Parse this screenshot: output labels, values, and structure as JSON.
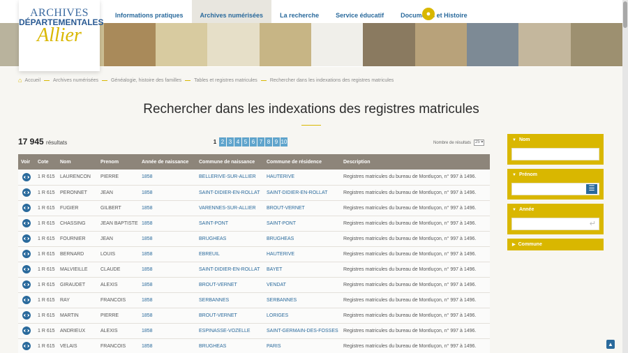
{
  "logo": {
    "line1": "ARCHIVES",
    "line2": "DÉPARTEMENTALES",
    "line3": "Allier"
  },
  "nav": [
    {
      "label": "Informations pratiques",
      "active": false
    },
    {
      "label": "Archives numérisées",
      "active": true
    },
    {
      "label": "La recherche",
      "active": false
    },
    {
      "label": "Service éducatif",
      "active": false
    },
    {
      "label": "Documents et Histoire",
      "active": false
    }
  ],
  "banner_colors": [
    "#b9b39d",
    "#cdbf94",
    "#a98a5a",
    "#d8cba0",
    "#e6dfc8",
    "#c7b585",
    "#f0efea",
    "#8a7a60",
    "#b8a27a",
    "#7d8a95",
    "#c4b79d",
    "#9d9070"
  ],
  "breadcrumb": [
    "Accueil",
    "Archives numérisées",
    "Généalogie, histoire des familles",
    "Tables et registres matricules",
    "Rechercher dans les indexations des registres matricules"
  ],
  "page_title": "Rechercher dans les indexations des registres matricules",
  "results": {
    "count": "17 945",
    "label": "résultats"
  },
  "pager": {
    "current": "1",
    "pages": [
      "2",
      "3",
      "4",
      "5",
      "6",
      "7",
      "8",
      "9",
      "10"
    ]
  },
  "per_page": {
    "label": "Nombre de résultats",
    "value": "25"
  },
  "table": {
    "headers": [
      "Voir",
      "Cote",
      "Nom",
      "Prenom",
      "Année de naissance",
      "Commune de naissance",
      "Commune de résidence",
      "Description"
    ],
    "rows": [
      [
        "1 R 615",
        "LAURENCON",
        "PIERRE",
        "1858",
        "BELLERIVE-SUR-ALLIER",
        "HAUTERIVE",
        "Registres matricules du bureau de Montluçon, n° 997 à 1496."
      ],
      [
        "1 R 615",
        "PERONNET",
        "JEAN",
        "1858",
        "SAINT-DIDIER-EN-ROLLAT",
        "SAINT-DIDIER-EN-ROLLAT",
        "Registres matricules du bureau de Montluçon, n° 997 à 1496."
      ],
      [
        "1 R 615",
        "FUGIER",
        "GILBERT",
        "1858",
        "VARENNES-SUR-ALLIER",
        "BROUT-VERNET",
        "Registres matricules du bureau de Montluçon, n° 997 à 1496."
      ],
      [
        "1 R 615",
        "CHASSING",
        "JEAN BAPTISTE",
        "1858",
        "SAINT-PONT",
        "SAINT-PONT",
        "Registres matricules du bureau de Montluçon, n° 997 à 1496."
      ],
      [
        "1 R 615",
        "FOURNIER",
        "JEAN",
        "1858",
        "BRUGHEAS",
        "BRUGHEAS",
        "Registres matricules du bureau de Montluçon, n° 997 à 1496."
      ],
      [
        "1 R 615",
        "BERNARD",
        "LOUIS",
        "1858",
        "EBREUIL",
        "HAUTERIVE",
        "Registres matricules du bureau de Montluçon, n° 997 à 1496."
      ],
      [
        "1 R 615",
        "MALVIEILLE",
        "CLAUDE",
        "1858",
        "SAINT-DIDIER-EN-ROLLAT",
        "BAYET",
        "Registres matricules du bureau de Montluçon, n° 997 à 1496."
      ],
      [
        "1 R 615",
        "GIRAUDET",
        "ALEXIS",
        "1858",
        "BROUT-VERNET",
        "VENDAT",
        "Registres matricules du bureau de Montluçon, n° 997 à 1496."
      ],
      [
        "1 R 615",
        "RAY",
        "FRANCOIS",
        "1858",
        "SERBANNES",
        "SERBANNES",
        "Registres matricules du bureau de Montluçon, n° 997 à 1496."
      ],
      [
        "1 R 615",
        "MARTIN",
        "PIERRE",
        "1858",
        "BROUT-VERNET",
        "LORIGES",
        "Registres matricules du bureau de Montluçon, n° 997 à 1496."
      ],
      [
        "1 R 615",
        "ANDRIEUX",
        "ALEXIS",
        "1858",
        "ESPINASSE-VOZELLE",
        "SAINT-GERMAIN-DES-FOSSES",
        "Registres matricules du bureau de Montluçon, n° 997 à 1496."
      ],
      [
        "1 R 615",
        "VELAIS",
        "FRANCOIS",
        "1858",
        "BRUGHEAS",
        "PARIS",
        "Registres matricules du bureau de Montluçon, n° 997 à 1496."
      ]
    ]
  },
  "filters": {
    "nom": {
      "label": "Nom",
      "value": ""
    },
    "prenom": {
      "label": "Prénom",
      "value": ""
    },
    "annee": {
      "label": "Année",
      "value": ""
    },
    "commune": {
      "label": "Commune"
    }
  },
  "accent_color": "#d9b700",
  "link_color": "#2a6a9c"
}
